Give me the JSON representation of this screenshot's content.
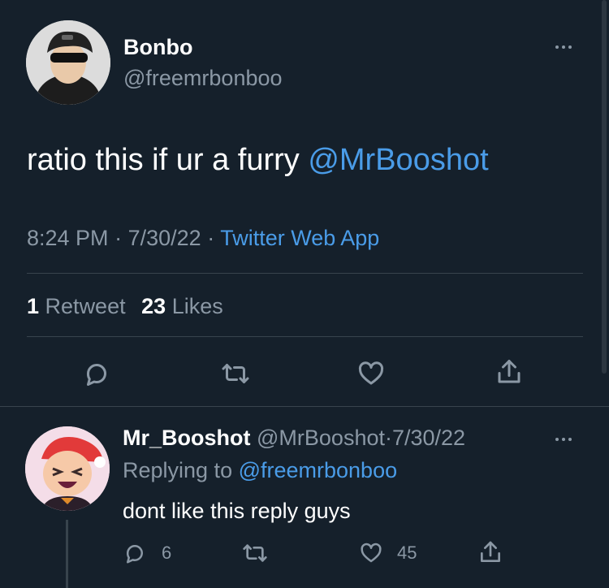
{
  "tweet": {
    "author_name": "Bonbo",
    "author_handle": "@freemrbonboo",
    "text_prefix": "ratio this if ur a furry ",
    "mention": "@MrBooshot",
    "time": "8:24 PM",
    "sep1": "·",
    "date": "7/30/22",
    "sep2": "·",
    "source": "Twitter Web App",
    "retweet_count": "1",
    "retweet_label": "Retweet",
    "like_count": "23",
    "like_label": "Likes"
  },
  "reply": {
    "author_name": "Mr_Booshot",
    "author_handle": "@MrBooshot",
    "sep": "·",
    "date": "7/30/22",
    "replying_prefix": "Replying to ",
    "replying_to": "@freemrbonboo",
    "text": "dont like this reply guys",
    "reply_count": "6",
    "like_count": "45"
  },
  "icons": {
    "tweet_actions": [
      "reply-icon",
      "retweet-icon",
      "like-icon",
      "share-icon"
    ],
    "reply_actions": [
      "reply-icon",
      "retweet-icon",
      "like-icon",
      "share-icon"
    ],
    "more": "more-icon"
  },
  "colors": {
    "background": "#15202b",
    "link": "#4a9ce8",
    "muted": "#8b98a5",
    "divider": "#38444d"
  }
}
